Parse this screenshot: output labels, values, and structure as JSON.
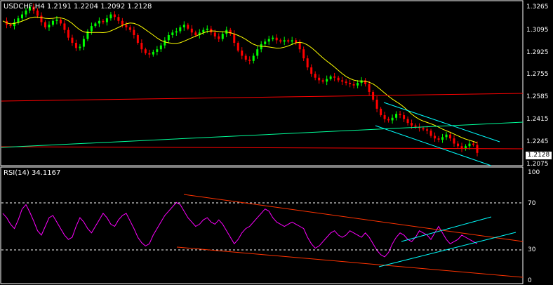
{
  "main_panel": {
    "title": "USDCHF,H4  1.2191 1.2204 1.2092 1.2128",
    "symbol": "USDCHF",
    "timeframe": "H4",
    "open": 1.2191,
    "high": 1.2204,
    "low": 1.2092,
    "close": 1.2128,
    "current_price_label": "1.2128",
    "price_ticks": [
      "1.3265",
      "1.3095",
      "1.2925",
      "1.2755",
      "1.2585",
      "1.2415",
      "1.2245",
      "1.2075"
    ],
    "price_range": [
      1.204,
      1.329
    ],
    "colors": {
      "background": "#000000",
      "grid": "#ffffff",
      "bull_candle": "#00ff00",
      "bear_candle": "#ff0000",
      "moving_average": "#ffff00",
      "horizontal_resistance": "#ff0000",
      "trendline_green": "#00ff00",
      "channel": "#00ffff"
    }
  },
  "rsi_panel": {
    "title": "RSI(14) 34.1167",
    "period": 14,
    "value": 34.1167,
    "levels_ticks": [
      "100",
      "70",
      "30",
      "0"
    ],
    "upper_level": 70,
    "lower_level": 30,
    "colors": {
      "rsi_line": "#ff00ff",
      "trendlines": "#ff0000",
      "channel": "#00ffff",
      "level_lines": "#ffffff"
    }
  },
  "chart_data": [
    {
      "type": "line",
      "title": "USDCHF,H4  1.2191 1.2204 1.2092 1.2128",
      "description": "Candlestick price series with 20-period moving average (approximate)",
      "ylim": [
        1.204,
        1.329
      ],
      "y_ticks": [
        1.3265,
        1.3095,
        1.2925,
        1.2755,
        1.2585,
        1.2415,
        1.2245,
        1.2075
      ],
      "series": [
        {
          "values": [
            1.315,
            1.312,
            1.311,
            1.314,
            1.317,
            1.32,
            1.323,
            1.326,
            1.323,
            1.319,
            1.314,
            1.31,
            1.312,
            1.315,
            1.316,
            1.313,
            1.308,
            1.302,
            1.298,
            1.294,
            1.295,
            1.301,
            1.307,
            1.311,
            1.313,
            1.315,
            1.314,
            1.317,
            1.32,
            1.318,
            1.315,
            1.312,
            1.31,
            1.308,
            1.304,
            1.298,
            1.293,
            1.29,
            1.289,
            1.291,
            1.293,
            1.296,
            1.3,
            1.304,
            1.306,
            1.307,
            1.31,
            1.312,
            1.309,
            1.306,
            1.304,
            1.306,
            1.308,
            1.309,
            1.306,
            1.303,
            1.301,
            1.305,
            1.308,
            1.305,
            1.298,
            1.292,
            1.288,
            1.285,
            1.284,
            1.288,
            1.293,
            1.297,
            1.299,
            1.301,
            1.302,
            1.3,
            1.299,
            1.3,
            1.299,
            1.3,
            1.298,
            1.293,
            1.286,
            1.279,
            1.274,
            1.271,
            1.269,
            1.268,
            1.27,
            1.272,
            1.271,
            1.269,
            1.268,
            1.267,
            1.266,
            1.265,
            1.267,
            1.269,
            1.266,
            1.26,
            1.254,
            1.247,
            1.242,
            1.239,
            1.238,
            1.24,
            1.243,
            1.242,
            1.239,
            1.236,
            1.234,
            1.233,
            1.232,
            1.231,
            1.23,
            1.226,
            1.224,
            1.223,
            1.225,
            1.227,
            1.224,
            1.22,
            1.218,
            1.216,
            1.218,
            1.22,
            1.219,
            1.2128
          ]
        }
      ]
    },
    {
      "type": "line",
      "title": "RSI(14) 34.1167",
      "ylim": [
        0,
        100
      ],
      "y_ticks": [
        100,
        70,
        30,
        0
      ],
      "series": [
        {
          "values": [
            62,
            58,
            52,
            48,
            56,
            66,
            70,
            63,
            55,
            46,
            42,
            50,
            58,
            60,
            54,
            48,
            42,
            38,
            40,
            50,
            58,
            54,
            48,
            44,
            50,
            56,
            62,
            58,
            52,
            50,
            56,
            60,
            62,
            55,
            48,
            40,
            35,
            32,
            34,
            42,
            48,
            54,
            60,
            64,
            68,
            72,
            70,
            64,
            58,
            54,
            50,
            52,
            56,
            58,
            54,
            52,
            56,
            52,
            46,
            40,
            34,
            38,
            44,
            48,
            50,
            54,
            58,
            62,
            66,
            64,
            58,
            54,
            52,
            50,
            52,
            54,
            52,
            50,
            48,
            40,
            34,
            30,
            32,
            36,
            40,
            44,
            46,
            42,
            40,
            42,
            46,
            44,
            42,
            40,
            44,
            40,
            34,
            28,
            24,
            22,
            26,
            34,
            40,
            44,
            42,
            38,
            36,
            40,
            46,
            44,
            42,
            38,
            44,
            50,
            44,
            38,
            34,
            36,
            38,
            42,
            40,
            38,
            36,
            34
          ]
        }
      ]
    }
  ]
}
